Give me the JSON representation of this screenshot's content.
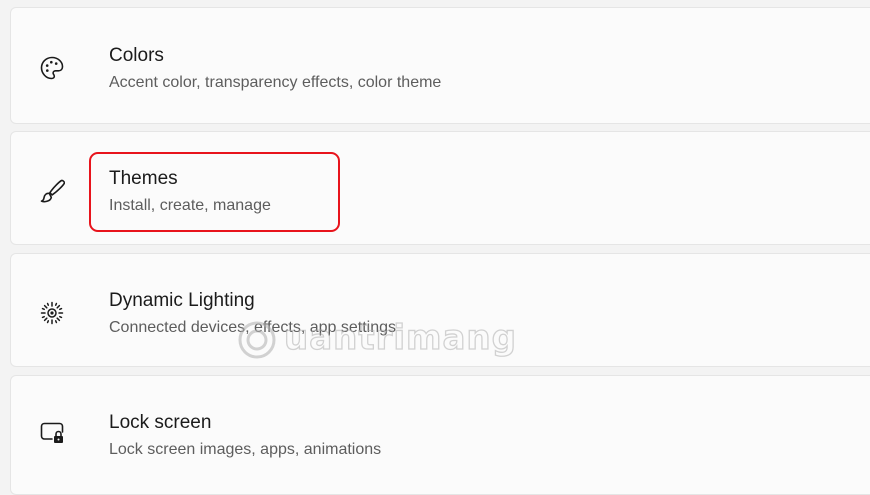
{
  "settings_list": [
    {
      "id": "colors",
      "icon": "palette-icon",
      "title": "Colors",
      "subtitle": "Accent color, transparency effects, color theme"
    },
    {
      "id": "themes",
      "icon": "brush-icon",
      "title": "Themes",
      "subtitle": "Install, create, manage",
      "highlighted": true
    },
    {
      "id": "dynamic-lighting",
      "icon": "dynamic-lighting-icon",
      "title": "Dynamic Lighting",
      "subtitle": "Connected devices, effects, app settings"
    },
    {
      "id": "lock-screen",
      "icon": "lock-screen-icon",
      "title": "Lock screen",
      "subtitle": "Lock screen images, apps, animations"
    }
  ],
  "annotation": {
    "highlight_color": "#e8141c"
  },
  "watermark": {
    "text": "uantrimang"
  }
}
